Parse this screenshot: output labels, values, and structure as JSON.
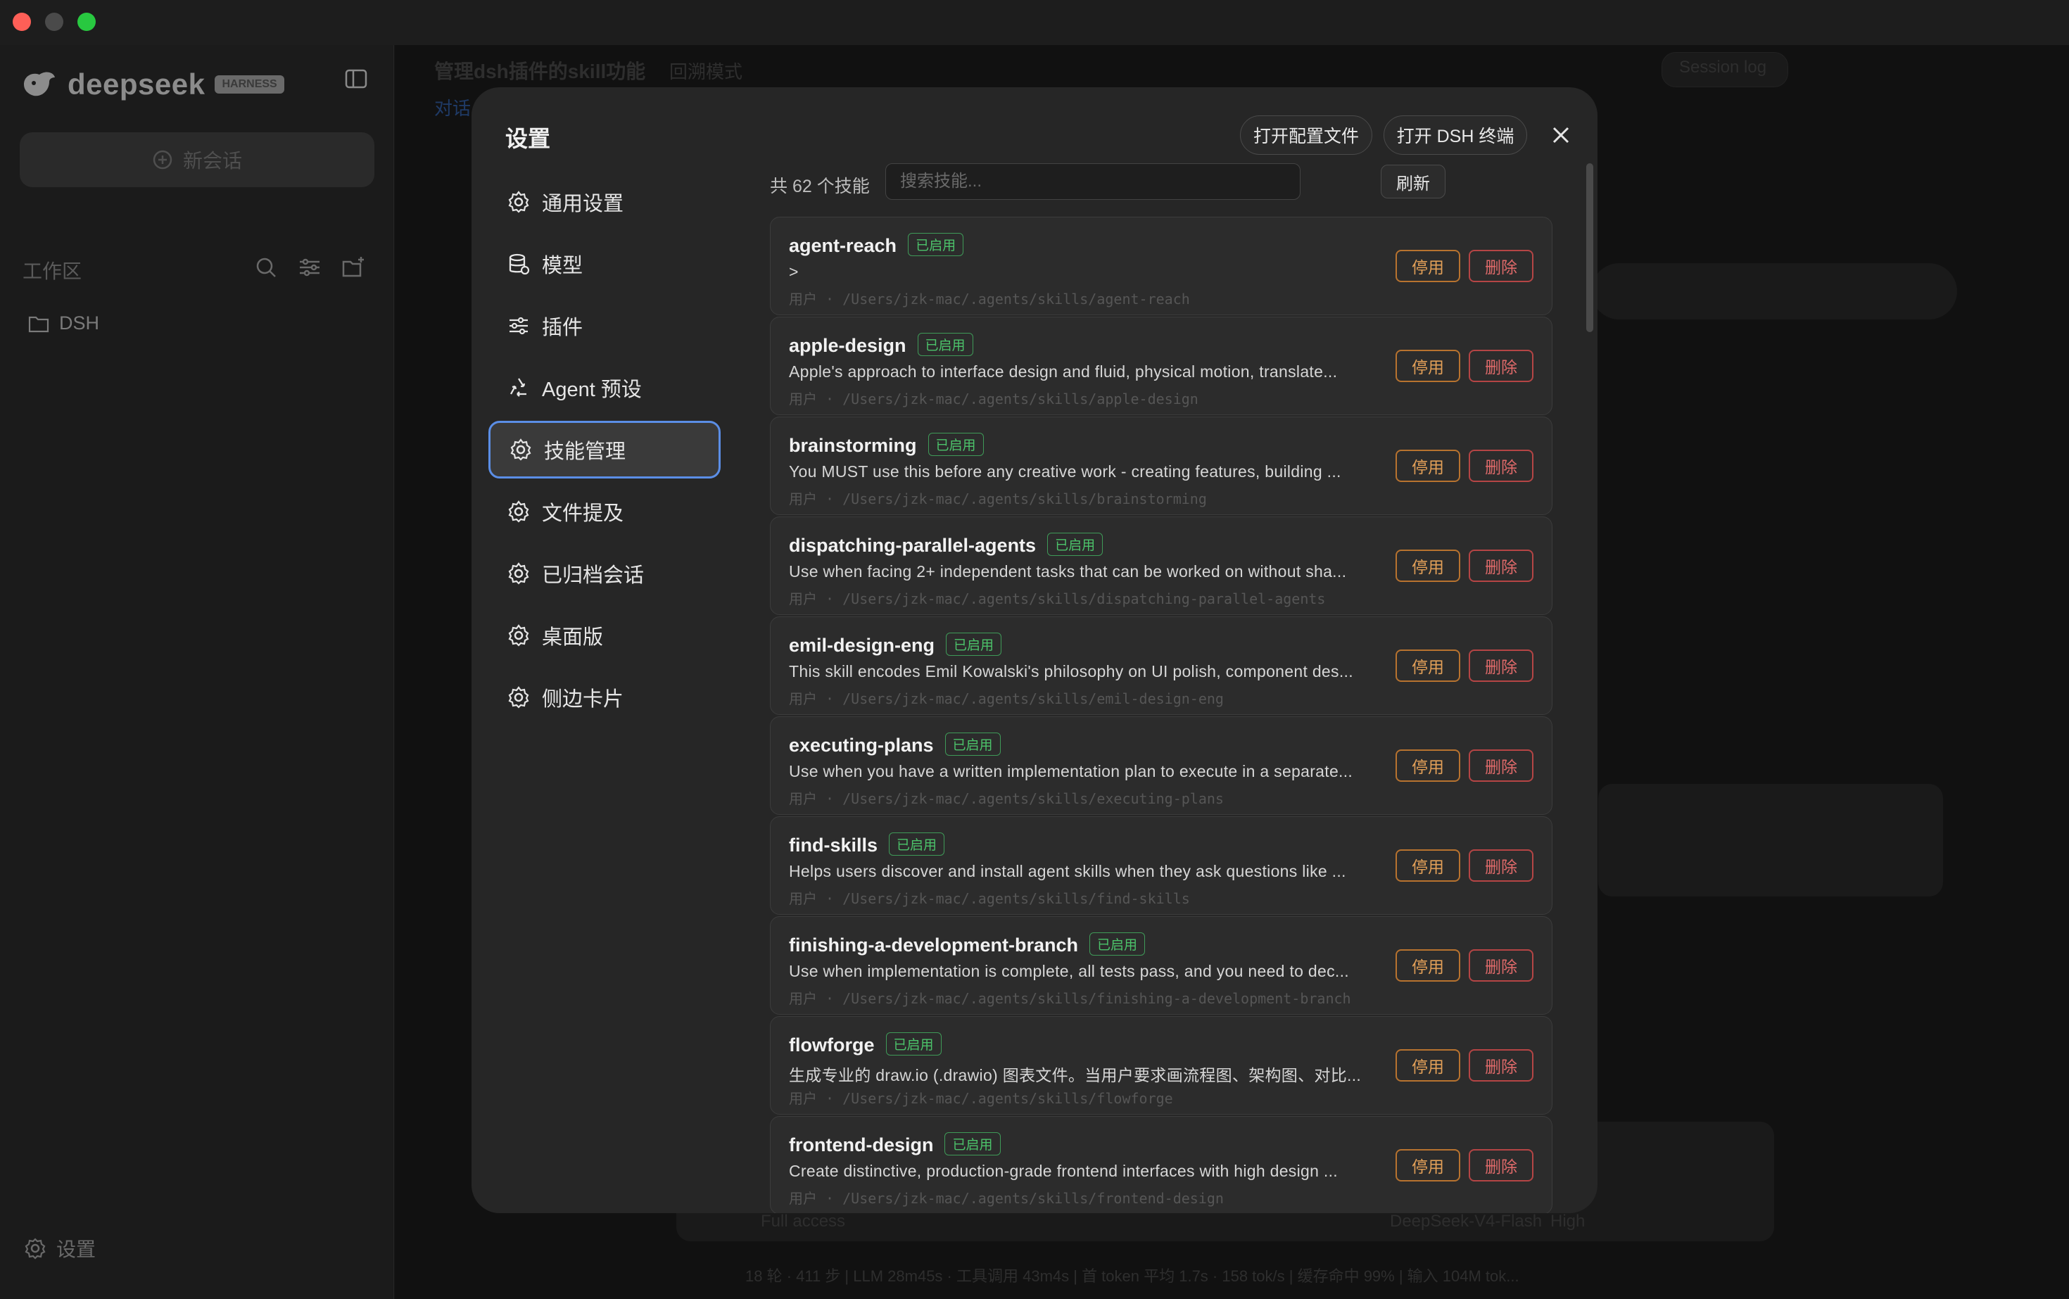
{
  "sidebar": {
    "brand": "deepseek",
    "brand_badge": "HARNESS",
    "new_chat": "新会话",
    "workspace_label": "工作区",
    "workspace_items": [
      {
        "name": "DSH"
      }
    ],
    "settings_label": "设置"
  },
  "background": {
    "session_title": "管理dsh插件的skill功能",
    "session_mode": "回溯模式",
    "session_log": "Session log",
    "tab": "对话",
    "access": "Full access",
    "model": "DeepSeek-V4-Flash",
    "level": "High",
    "status_bar": "18 轮 · 411 步 | LLM 28m45s · 工具调用 43m4s | 首 token 平均 1.7s · 158 tok/s | 缓存命中 99% | 输入 104M tok..."
  },
  "modal": {
    "title": "设置",
    "buttons": {
      "open_config": "打开配置文件",
      "open_terminal": "打开 DSH 终端"
    },
    "nav": [
      {
        "label": "通用设置",
        "icon": "gear-icon"
      },
      {
        "label": "模型",
        "icon": "database-icon"
      },
      {
        "label": "插件",
        "icon": "sliders-icon"
      },
      {
        "label": "Agent 预设",
        "icon": "recycle-icon"
      },
      {
        "label": "技能管理",
        "icon": "gear-icon",
        "active": true
      },
      {
        "label": "文件提及",
        "icon": "gear-icon"
      },
      {
        "label": "已归档会话",
        "icon": "gear-icon"
      },
      {
        "label": "桌面版",
        "icon": "gear-icon"
      },
      {
        "label": "侧边卡片",
        "icon": "gear-icon"
      }
    ],
    "skills_count": "共 62 个技能",
    "search_placeholder": "搜索技能...",
    "refresh_label": "刷新",
    "enabled_badge": "已启用",
    "disable_label": "停用",
    "delete_label": "删除",
    "skills": [
      {
        "name": "agent-reach",
        "desc": ">",
        "meta": "用户 · /Users/jzk-mac/.agents/skills/agent-reach"
      },
      {
        "name": "apple-design",
        "desc": "Apple's approach to interface design and fluid, physical motion, translate...",
        "meta": "用户 · /Users/jzk-mac/.agents/skills/apple-design"
      },
      {
        "name": "brainstorming",
        "desc": "You MUST use this before any creative work - creating features, building ...",
        "meta": "用户 · /Users/jzk-mac/.agents/skills/brainstorming"
      },
      {
        "name": "dispatching-parallel-agents",
        "desc": "Use when facing 2+ independent tasks that can be worked on without sha...",
        "meta": "用户 · /Users/jzk-mac/.agents/skills/dispatching-parallel-agents"
      },
      {
        "name": "emil-design-eng",
        "desc": "This skill encodes Emil Kowalski's philosophy on UI polish, component des...",
        "meta": "用户 · /Users/jzk-mac/.agents/skills/emil-design-eng"
      },
      {
        "name": "executing-plans",
        "desc": "Use when you have a written implementation plan to execute in a separate...",
        "meta": "用户 · /Users/jzk-mac/.agents/skills/executing-plans"
      },
      {
        "name": "find-skills",
        "desc": "Helps users discover and install agent skills when they ask questions like ...",
        "meta": "用户 · /Users/jzk-mac/.agents/skills/find-skills"
      },
      {
        "name": "finishing-a-development-branch",
        "desc": "Use when implementation is complete, all tests pass, and you need to dec...",
        "meta": "用户 · /Users/jzk-mac/.agents/skills/finishing-a-development-branch"
      },
      {
        "name": "flowforge",
        "desc": "生成专业的 draw.io (.drawio) 图表文件。当用户要求画流程图、架构图、对比...",
        "meta": "用户 · /Users/jzk-mac/.agents/skills/flowforge"
      },
      {
        "name": "frontend-design",
        "desc": "Create distinctive, production-grade frontend interfaces with high design ...",
        "meta": "用户 · /Users/jzk-mac/.agents/skills/frontend-design"
      }
    ]
  },
  "colors": {
    "accent": "#5b8ee6",
    "enabled": "#4cc36a",
    "disable": "#e3a058",
    "delete": "#e06a6a"
  }
}
